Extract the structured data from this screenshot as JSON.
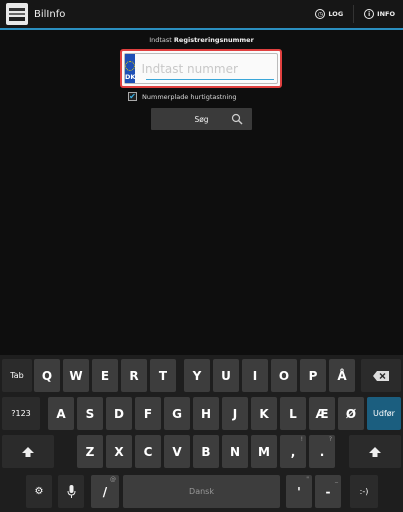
{
  "actionbar": {
    "title": "BilInfo",
    "log_label": "LOG",
    "info_label": "INFO"
  },
  "form": {
    "label_prefix": "Indtast ",
    "label_bold": "Registreringsnummer",
    "plate_country": "DK",
    "plate_placeholder": "Indtast nummer",
    "checkbox_label": "Nummerplade hurtigtastning",
    "checkbox_checked": true,
    "search_label": "Søg"
  },
  "keyboard": {
    "row1": [
      "Q",
      "W",
      "E",
      "R",
      "T",
      "Y",
      "U",
      "I",
      "O",
      "P",
      "Å"
    ],
    "row2": [
      "A",
      "S",
      "D",
      "F",
      "G",
      "H",
      "J",
      "K",
      "L",
      "Æ",
      "Ø"
    ],
    "row3": [
      "Z",
      "X",
      "C",
      "V",
      "B",
      "N",
      "M",
      "!",
      "?"
    ],
    "tab": "Tab",
    "num": "?123",
    "go": "Udfør",
    "space": "Dansk",
    "slash": "/",
    "slash_hint": "@",
    "apostrophe": "'",
    "apostrophe_hint": "\"",
    "dash": "-",
    "dash_hint": "_",
    "smiley": ":-)",
    "comma_hint": "!",
    "period_hint": "?"
  },
  "colors": {
    "accent": "#2b8fc0",
    "highlight": "#e0403f",
    "go_key": "#1b5e7f"
  }
}
